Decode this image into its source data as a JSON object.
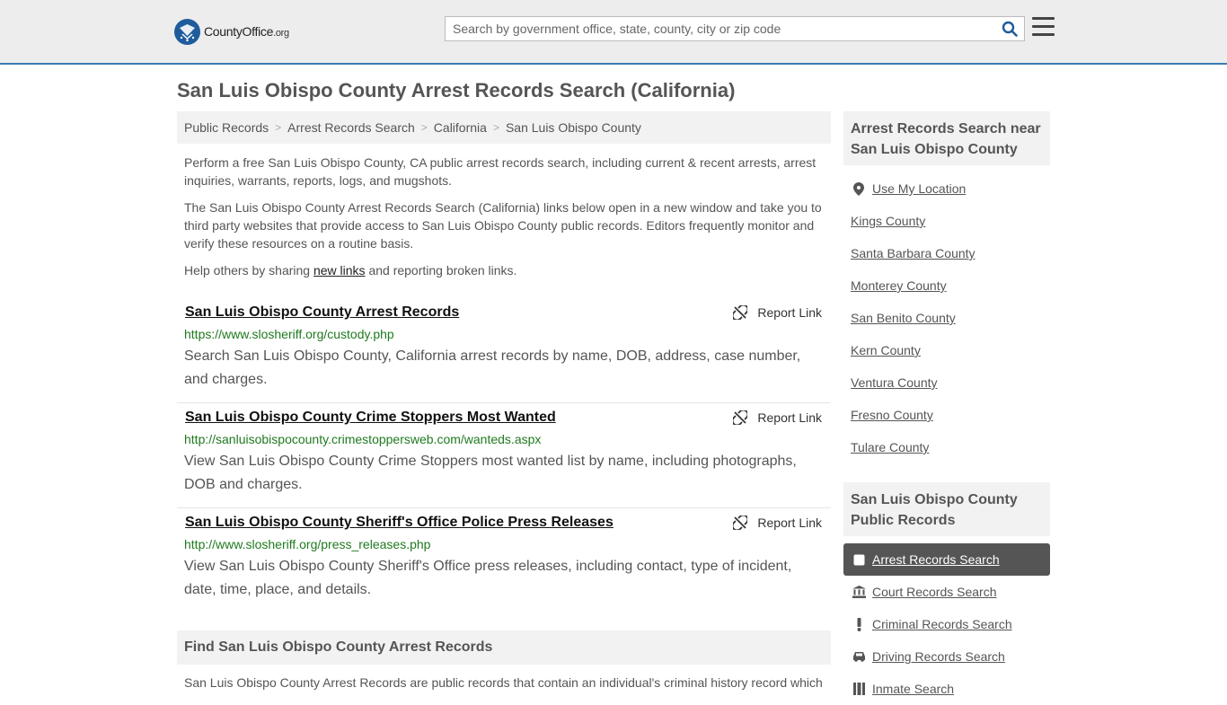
{
  "header": {
    "logo_text": "CountyOffice",
    "logo_suffix": ".org",
    "search_placeholder": "Search by government office, state, county, city or zip code"
  },
  "page_title": "San Luis Obispo County Arrest Records Search (California)",
  "breadcrumb": [
    "Public Records",
    "Arrest Records Search",
    "California",
    "San Luis Obispo County"
  ],
  "intro": {
    "p1": "Perform a free San Luis Obispo County, CA public arrest records search, including current & recent arrests, arrest inquiries, warrants, reports, logs, and mugshots.",
    "p2": "The San Luis Obispo County Arrest Records Search (California) links below open in a new window and take you to third party websites that provide access to San Luis Obispo County public records. Editors frequently monitor and verify these resources on a routine basis.",
    "p3_before": "Help others by sharing ",
    "p3_link": "new links",
    "p3_after": " and reporting broken links."
  },
  "report_label": "Report Link",
  "records": [
    {
      "title": "San Luis Obispo County Arrest Records",
      "url": "https://www.slosheriff.org/custody.php",
      "desc": "Search San Luis Obispo County, California arrest records by name, DOB, address, case number, and charges."
    },
    {
      "title": "San Luis Obispo County Crime Stoppers Most Wanted",
      "url": "http://sanluisobispocounty.crimestoppersweb.com/wanteds.aspx",
      "desc": "View San Luis Obispo County Crime Stoppers most wanted list by name, including photographs, DOB and charges."
    },
    {
      "title": "San Luis Obispo County Sheriff's Office Police Press Releases",
      "url": "http://www.slosheriff.org/press_releases.php",
      "desc": "View San Luis Obispo County Sheriff's Office press releases, including contact, type of incident, date, time, place, and details."
    }
  ],
  "find": {
    "heading": "Find San Luis Obispo County Arrest Records",
    "text": "San Luis Obispo County Arrest Records are public records that contain an individual's criminal history record which"
  },
  "sidebar": {
    "nearby_heading": "Arrest Records Search near San Luis Obispo County",
    "use_location": "Use My Location",
    "nearby": [
      "Kings County",
      "Santa Barbara County",
      "Monterey County",
      "San Benito County",
      "Kern County",
      "Ventura County",
      "Fresno County",
      "Tulare County"
    ],
    "public_heading": "San Luis Obispo County Public Records",
    "categories": [
      "Arrest Records Search",
      "Court Records Search",
      "Criminal Records Search",
      "Driving Records Search",
      "Inmate Search"
    ]
  },
  "colors": {
    "accent_border": "#3d7bb6",
    "url_green": "#1f7a1f",
    "active_item": "#555555"
  }
}
